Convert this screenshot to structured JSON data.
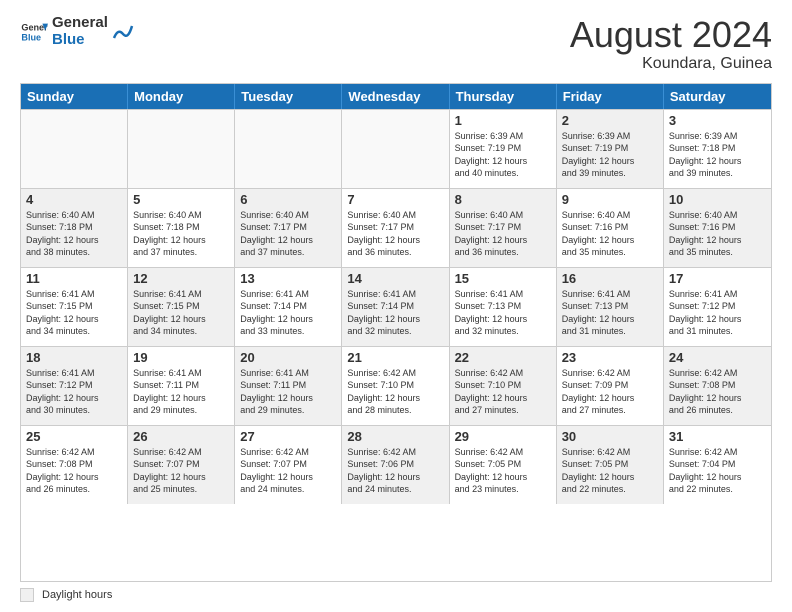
{
  "header": {
    "logo_general": "General",
    "logo_blue": "Blue",
    "month_year": "August 2024",
    "location": "Koundara, Guinea"
  },
  "weekdays": [
    "Sunday",
    "Monday",
    "Tuesday",
    "Wednesday",
    "Thursday",
    "Friday",
    "Saturday"
  ],
  "footer": {
    "daylight_label": "Daylight hours"
  },
  "rows": [
    {
      "cells": [
        {
          "num": "",
          "info": "",
          "empty": true
        },
        {
          "num": "",
          "info": "",
          "empty": true
        },
        {
          "num": "",
          "info": "",
          "empty": true
        },
        {
          "num": "",
          "info": "",
          "empty": true
        },
        {
          "num": "1",
          "info": "Sunrise: 6:39 AM\nSunset: 7:19 PM\nDaylight: 12 hours\nand 40 minutes.",
          "shaded": false
        },
        {
          "num": "2",
          "info": "Sunrise: 6:39 AM\nSunset: 7:19 PM\nDaylight: 12 hours\nand 39 minutes.",
          "shaded": true
        },
        {
          "num": "3",
          "info": "Sunrise: 6:39 AM\nSunset: 7:18 PM\nDaylight: 12 hours\nand 39 minutes.",
          "shaded": false
        }
      ]
    },
    {
      "cells": [
        {
          "num": "4",
          "info": "Sunrise: 6:40 AM\nSunset: 7:18 PM\nDaylight: 12 hours\nand 38 minutes.",
          "shaded": true
        },
        {
          "num": "5",
          "info": "Sunrise: 6:40 AM\nSunset: 7:18 PM\nDaylight: 12 hours\nand 37 minutes.",
          "shaded": false
        },
        {
          "num": "6",
          "info": "Sunrise: 6:40 AM\nSunset: 7:17 PM\nDaylight: 12 hours\nand 37 minutes.",
          "shaded": true
        },
        {
          "num": "7",
          "info": "Sunrise: 6:40 AM\nSunset: 7:17 PM\nDaylight: 12 hours\nand 36 minutes.",
          "shaded": false
        },
        {
          "num": "8",
          "info": "Sunrise: 6:40 AM\nSunset: 7:17 PM\nDaylight: 12 hours\nand 36 minutes.",
          "shaded": true
        },
        {
          "num": "9",
          "info": "Sunrise: 6:40 AM\nSunset: 7:16 PM\nDaylight: 12 hours\nand 35 minutes.",
          "shaded": false
        },
        {
          "num": "10",
          "info": "Sunrise: 6:40 AM\nSunset: 7:16 PM\nDaylight: 12 hours\nand 35 minutes.",
          "shaded": true
        }
      ]
    },
    {
      "cells": [
        {
          "num": "11",
          "info": "Sunrise: 6:41 AM\nSunset: 7:15 PM\nDaylight: 12 hours\nand 34 minutes.",
          "shaded": false
        },
        {
          "num": "12",
          "info": "Sunrise: 6:41 AM\nSunset: 7:15 PM\nDaylight: 12 hours\nand 34 minutes.",
          "shaded": true
        },
        {
          "num": "13",
          "info": "Sunrise: 6:41 AM\nSunset: 7:14 PM\nDaylight: 12 hours\nand 33 minutes.",
          "shaded": false
        },
        {
          "num": "14",
          "info": "Sunrise: 6:41 AM\nSunset: 7:14 PM\nDaylight: 12 hours\nand 32 minutes.",
          "shaded": true
        },
        {
          "num": "15",
          "info": "Sunrise: 6:41 AM\nSunset: 7:13 PM\nDaylight: 12 hours\nand 32 minutes.",
          "shaded": false
        },
        {
          "num": "16",
          "info": "Sunrise: 6:41 AM\nSunset: 7:13 PM\nDaylight: 12 hours\nand 31 minutes.",
          "shaded": true
        },
        {
          "num": "17",
          "info": "Sunrise: 6:41 AM\nSunset: 7:12 PM\nDaylight: 12 hours\nand 31 minutes.",
          "shaded": false
        }
      ]
    },
    {
      "cells": [
        {
          "num": "18",
          "info": "Sunrise: 6:41 AM\nSunset: 7:12 PM\nDaylight: 12 hours\nand 30 minutes.",
          "shaded": true
        },
        {
          "num": "19",
          "info": "Sunrise: 6:41 AM\nSunset: 7:11 PM\nDaylight: 12 hours\nand 29 minutes.",
          "shaded": false
        },
        {
          "num": "20",
          "info": "Sunrise: 6:41 AM\nSunset: 7:11 PM\nDaylight: 12 hours\nand 29 minutes.",
          "shaded": true
        },
        {
          "num": "21",
          "info": "Sunrise: 6:42 AM\nSunset: 7:10 PM\nDaylight: 12 hours\nand 28 minutes.",
          "shaded": false
        },
        {
          "num": "22",
          "info": "Sunrise: 6:42 AM\nSunset: 7:10 PM\nDaylight: 12 hours\nand 27 minutes.",
          "shaded": true
        },
        {
          "num": "23",
          "info": "Sunrise: 6:42 AM\nSunset: 7:09 PM\nDaylight: 12 hours\nand 27 minutes.",
          "shaded": false
        },
        {
          "num": "24",
          "info": "Sunrise: 6:42 AM\nSunset: 7:08 PM\nDaylight: 12 hours\nand 26 minutes.",
          "shaded": true
        }
      ]
    },
    {
      "cells": [
        {
          "num": "25",
          "info": "Sunrise: 6:42 AM\nSunset: 7:08 PM\nDaylight: 12 hours\nand 26 minutes.",
          "shaded": false
        },
        {
          "num": "26",
          "info": "Sunrise: 6:42 AM\nSunset: 7:07 PM\nDaylight: 12 hours\nand 25 minutes.",
          "shaded": true
        },
        {
          "num": "27",
          "info": "Sunrise: 6:42 AM\nSunset: 7:07 PM\nDaylight: 12 hours\nand 24 minutes.",
          "shaded": false
        },
        {
          "num": "28",
          "info": "Sunrise: 6:42 AM\nSunset: 7:06 PM\nDaylight: 12 hours\nand 24 minutes.",
          "shaded": true
        },
        {
          "num": "29",
          "info": "Sunrise: 6:42 AM\nSunset: 7:05 PM\nDaylight: 12 hours\nand 23 minutes.",
          "shaded": false
        },
        {
          "num": "30",
          "info": "Sunrise: 6:42 AM\nSunset: 7:05 PM\nDaylight: 12 hours\nand 22 minutes.",
          "shaded": true
        },
        {
          "num": "31",
          "info": "Sunrise: 6:42 AM\nSunset: 7:04 PM\nDaylight: 12 hours\nand 22 minutes.",
          "shaded": false
        }
      ]
    }
  ]
}
